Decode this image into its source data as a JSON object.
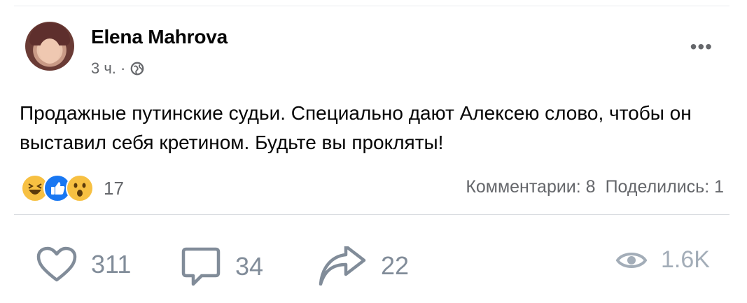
{
  "post": {
    "author": "Elena Mahrova",
    "time": "3 ч. ·",
    "more_label": "•••",
    "text": "Продажные путинские судьи. Специально дают Алексею слово, чтобы он выставил себя кретином. Будьте вы прокляты!",
    "reaction_count": "17",
    "comments_stat": "Комментарии: 8",
    "shares_stat": "Поделились: 1"
  },
  "footer": {
    "likes": "311",
    "comments": "34",
    "shares": "22",
    "views": "1.6K"
  },
  "icons": {
    "reactions": [
      "haha-reaction-icon",
      "like-reaction-icon",
      "wow-reaction-icon"
    ],
    "footer": [
      "heart-icon",
      "comment-icon",
      "share-icon",
      "eye-icon"
    ]
  },
  "colors": {
    "text": "#050505",
    "muted": "#65676b",
    "like_blue": "#1877f2",
    "emoji_yellow": "#f7c042",
    "footer_gray": "#818c99"
  }
}
